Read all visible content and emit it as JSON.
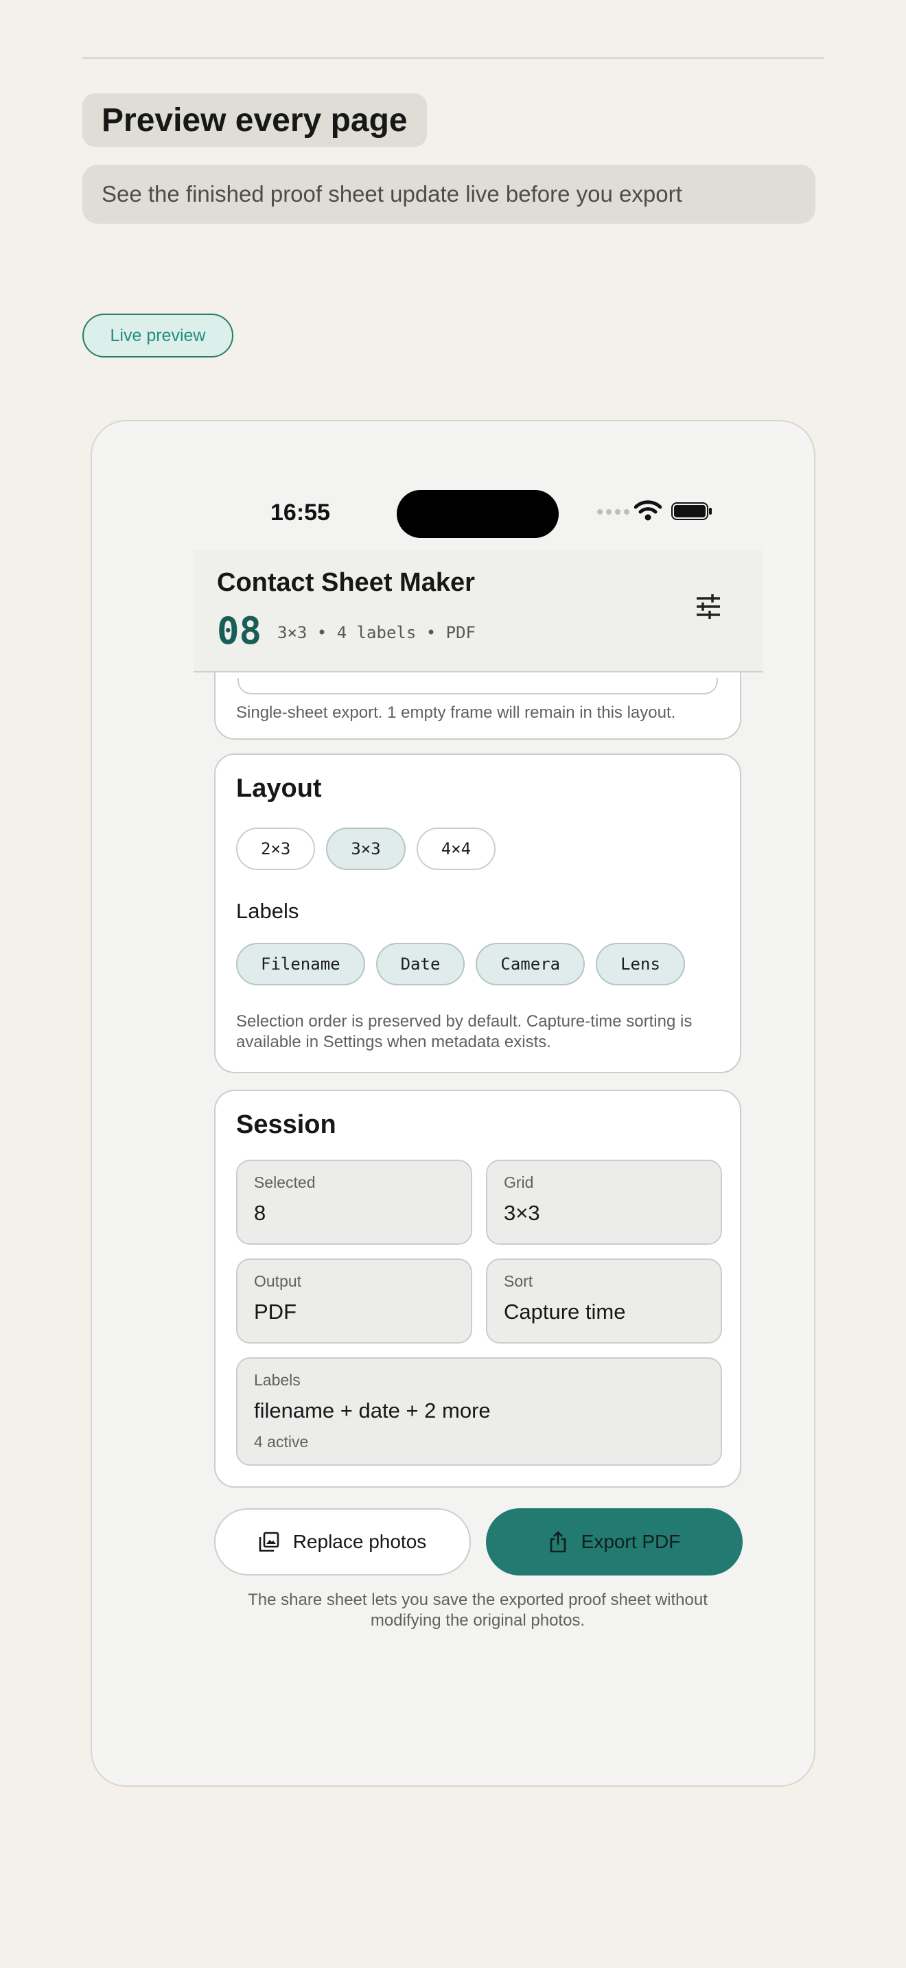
{
  "page": {
    "headline": "Preview every page",
    "subline": "See the finished proof sheet update live before you export",
    "tag": "Live preview"
  },
  "status_bar": {
    "time": "16:55"
  },
  "app": {
    "title": "Contact Sheet Maker",
    "count": "08",
    "meta": "3×3 • 4 labels • PDF",
    "settings_icon": "sliders-icon"
  },
  "export_card": {
    "note": "Single-sheet export. 1 empty frame will remain in this layout."
  },
  "layout_card": {
    "title": "Layout",
    "grid_options": [
      {
        "label": "2×3",
        "active": false
      },
      {
        "label": "3×3",
        "active": true
      },
      {
        "label": "4×4",
        "active": false
      }
    ],
    "labels_title": "Labels",
    "label_options": [
      {
        "label": "Filename",
        "active": true
      },
      {
        "label": "Date",
        "active": true
      },
      {
        "label": "Camera",
        "active": true
      },
      {
        "label": "Lens",
        "active": true
      }
    ],
    "note": "Selection order is preserved by default. Capture-time sorting is available in Settings when metadata exists."
  },
  "session_card": {
    "title": "Session",
    "selected": {
      "label": "Selected",
      "value": "8"
    },
    "grid": {
      "label": "Grid",
      "value": "3×3"
    },
    "output": {
      "label": "Output",
      "value": "PDF"
    },
    "sort": {
      "label": "Sort",
      "value": "Capture time"
    },
    "labels": {
      "label": "Labels",
      "value": "filename + date + 2 more",
      "sub": "4 active"
    }
  },
  "actions": {
    "replace_label": "Replace photos",
    "replace_icon": "photo-library-icon",
    "export_label": "Export PDF",
    "export_icon": "share-icon"
  },
  "footer": {
    "note": "The share sheet lets you save the exported proof sheet without modifying the original photos."
  },
  "colors": {
    "accent": "#237a70",
    "background": "#f4f0ea",
    "chip_active": "#e0eceb"
  }
}
